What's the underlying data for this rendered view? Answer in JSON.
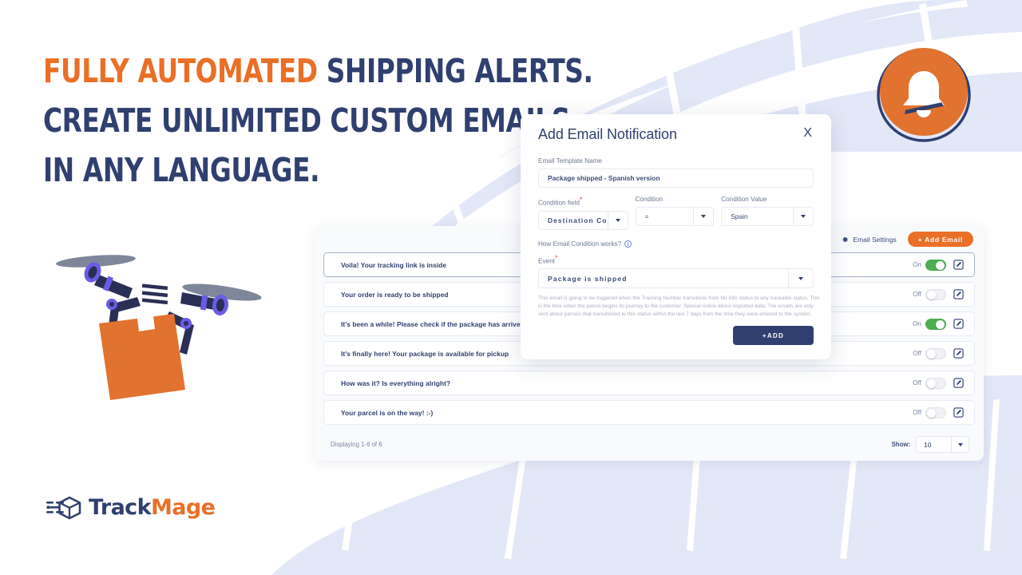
{
  "headline": {
    "line1_orange": "FULLY AUTOMATED",
    "line1_rest": "SHIPPING ALERTS.",
    "line2": "CREATE UNLIMITED CUSTOM EMAILS,",
    "line3": "IN ANY LANGUAGE."
  },
  "colors": {
    "navy": "#2f4070",
    "orange": "#ea6f27",
    "green": "#4caf50",
    "bg_leaf": "#e3e8f8",
    "card_bg": "#f9fafc"
  },
  "brand": {
    "logo_name_first": "Track",
    "logo_name_second": "Mage",
    "logo_icon": "shipping-box-icon"
  },
  "bell_badge": {
    "icon": "bell-icon"
  },
  "drone": {
    "icon": "delivery-drone-illustration"
  },
  "card": {
    "toolbar": {
      "settings_label": "Email Settings",
      "settings_icon": "gear-icon",
      "add_email_label": "+ Add Email"
    },
    "rows": [
      {
        "label": "Voila! Your tracking link is inside",
        "state_label": "On",
        "on": true,
        "selected": true
      },
      {
        "label": "Your order is ready to be shipped",
        "state_label": "Off",
        "on": false,
        "selected": false
      },
      {
        "label": "It's been a while! Please check if the package has arrived",
        "state_label": "On",
        "on": true,
        "selected": false
      },
      {
        "label": "It's finally here! Your package is available for pickup",
        "state_label": "Off",
        "on": false,
        "selected": false
      },
      {
        "label": "How was it? Is everything alright?",
        "state_label": "Off",
        "on": false,
        "selected": false
      },
      {
        "label": "Your parcel is on the way! :-)",
        "state_label": "Off",
        "on": false,
        "selected": false
      }
    ],
    "footer": {
      "displaying": "Displaying 1-6 of 6",
      "show_label": "Show:",
      "show_value": "10"
    }
  },
  "modal": {
    "title": "Add Email Notification",
    "close_label": "X",
    "template_name_label": "Email Template Name",
    "template_name_value": "Package shipped - Spanish version",
    "template_name_placeholder": "Email Template Name",
    "condition_field_label": "Condition field",
    "condition_field_value": "Destination Co",
    "condition_label": "Condition",
    "condition_value": "=",
    "condition_value_label": "Condition Value",
    "condition_value_value": "Spain",
    "how_works_label": "How Email Condition works?",
    "how_works_icon": "info-icon",
    "event_label": "Event",
    "event_value": "Package is shipped",
    "help_text": "This email is going to be triggered when the Tracking Number transitions from No Info status to any trackable status. This is the time when the parcel begins its journey to the customer. Special notice about imported data: The emails are only sent about parcels that transitioned to this status within the last 7 days from the time they were entered to the system.",
    "add_label": "+ADD"
  }
}
